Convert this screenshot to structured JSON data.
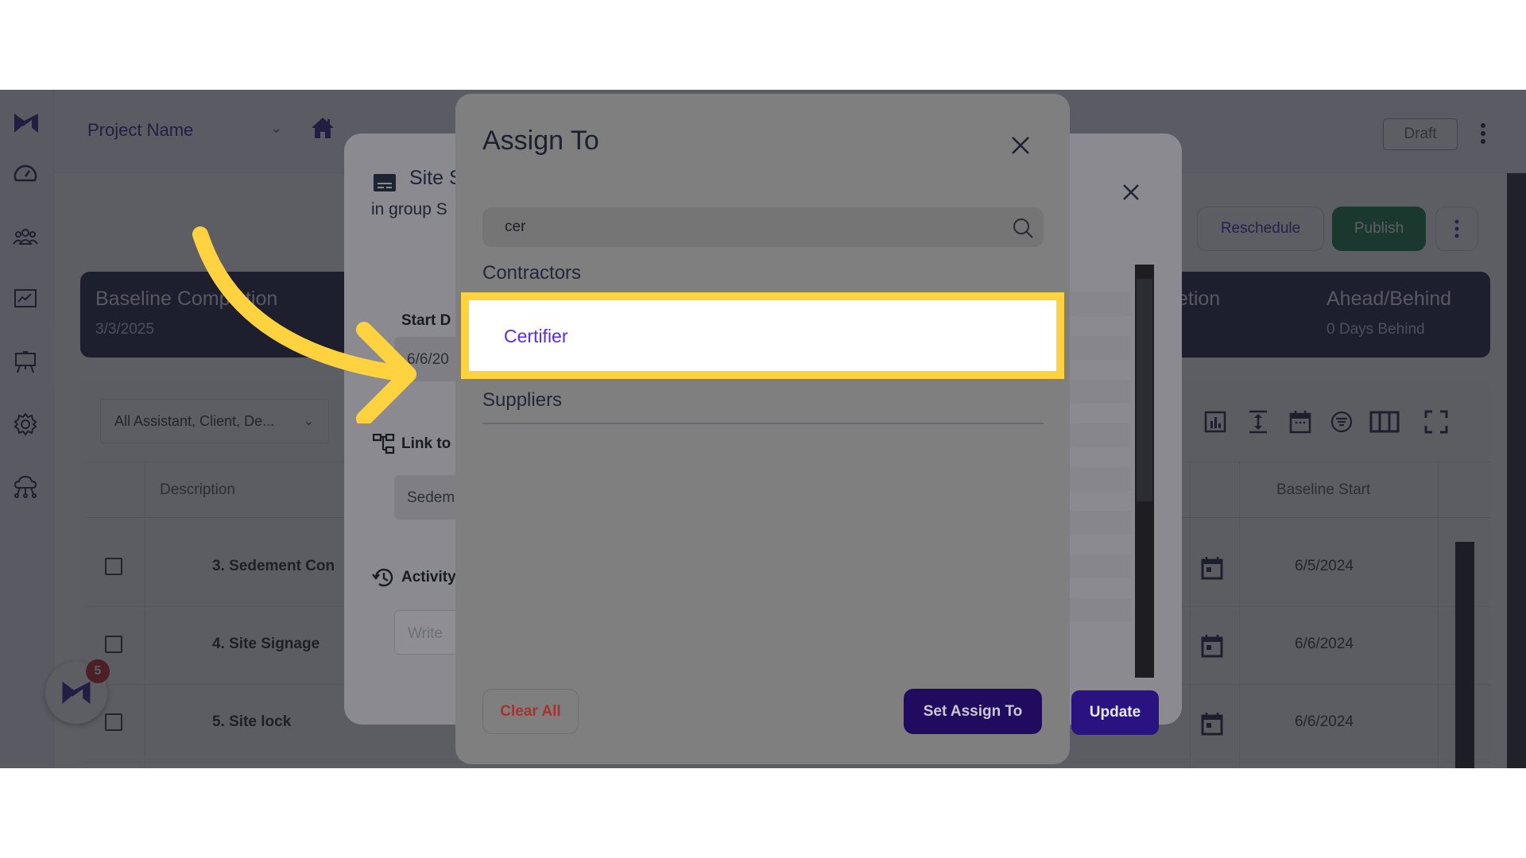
{
  "app": {
    "project_name": "Project Name",
    "status_badge": "Draft"
  },
  "sidebar": {
    "items": [
      {
        "icon": "dashboard-gauge-icon"
      },
      {
        "icon": "team-icon"
      },
      {
        "icon": "analytics-chart-icon"
      },
      {
        "icon": "presentation-board-icon"
      },
      {
        "icon": "settings-gear-icon"
      },
      {
        "icon": "cloud-network-icon"
      }
    ],
    "expand_label": ">"
  },
  "actions": {
    "reschedule": "Reschedule",
    "publish": "Publish"
  },
  "stats": {
    "baseline_completion_title": "Baseline Completion",
    "baseline_completion_value": "3/3/2025",
    "completion_title_partial": "etion",
    "ahead_behind_title": "Ahead/Behind",
    "ahead_behind_value": "0 Days Behind"
  },
  "table": {
    "filter_value": "All Assistant, Client, De...",
    "columns": {
      "description": "Description",
      "baseline_start": "Baseline Start"
    },
    "rows": [
      {
        "description": "3. Sedement Con",
        "baseline_start": "6/5/2024"
      },
      {
        "description": "4. Site Signage",
        "baseline_start": "6/6/2024"
      },
      {
        "description": "5. Site lock",
        "baseline_start": "6/6/2024"
      }
    ],
    "toolbar_icons": [
      "chart-icon",
      "row-height-icon",
      "calendar-icon",
      "filter-icon",
      "columns-icon",
      "fullscreen-icon"
    ]
  },
  "detail_modal": {
    "title": "Site S",
    "subtitle": "in group S",
    "start_date_label": "Start D",
    "start_date_value": "6/6/20",
    "link_label": "Link to",
    "link_value": "Sedem",
    "activity_label": "Activity",
    "activity_placeholder": "Write",
    "update_button": "Update"
  },
  "assign_modal": {
    "title": "Assign To",
    "search_value": "cer",
    "sections": [
      {
        "label": "Contractors",
        "items": [
          "Certifier"
        ]
      },
      {
        "label": "Suppliers",
        "items": []
      }
    ],
    "clear_all": "Clear All",
    "set_assign": "Set Assign To"
  },
  "chat": {
    "badge_count": "5"
  },
  "colors": {
    "brand_purple": "#2b1a8a",
    "publish_green": "#157a3e",
    "highlight_yellow": "#ffd23f",
    "item_text_purple": "#5b2be0",
    "clear_red": "#a6332e"
  }
}
